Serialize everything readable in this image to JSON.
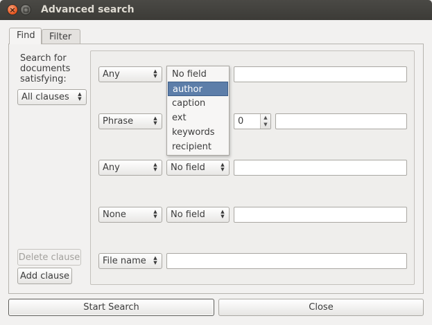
{
  "window": {
    "title": "Advanced search"
  },
  "tabs": [
    {
      "label": "Find"
    },
    {
      "label": "Filter"
    }
  ],
  "left": {
    "label_lines": [
      "Search for",
      "documents",
      "satisfying:"
    ],
    "match_mode": "All clauses",
    "delete_clause": "Delete clause",
    "add_clause": "Add clause"
  },
  "clauses": [
    {
      "type": "Any",
      "field": "No field",
      "value": ""
    },
    {
      "type": "Phrase",
      "proximity": "0",
      "value": ""
    },
    {
      "type": "Any",
      "field": "No field",
      "value": ""
    },
    {
      "type": "None",
      "field": "No field",
      "value": ""
    },
    {
      "type": "File name",
      "value": ""
    }
  ],
  "field_dropdown": {
    "items": [
      "No field",
      "author",
      "caption",
      "ext",
      "keywords",
      "recipient"
    ],
    "selected_index": 1
  },
  "footer": {
    "start_search": "Start Search",
    "close": "Close"
  }
}
